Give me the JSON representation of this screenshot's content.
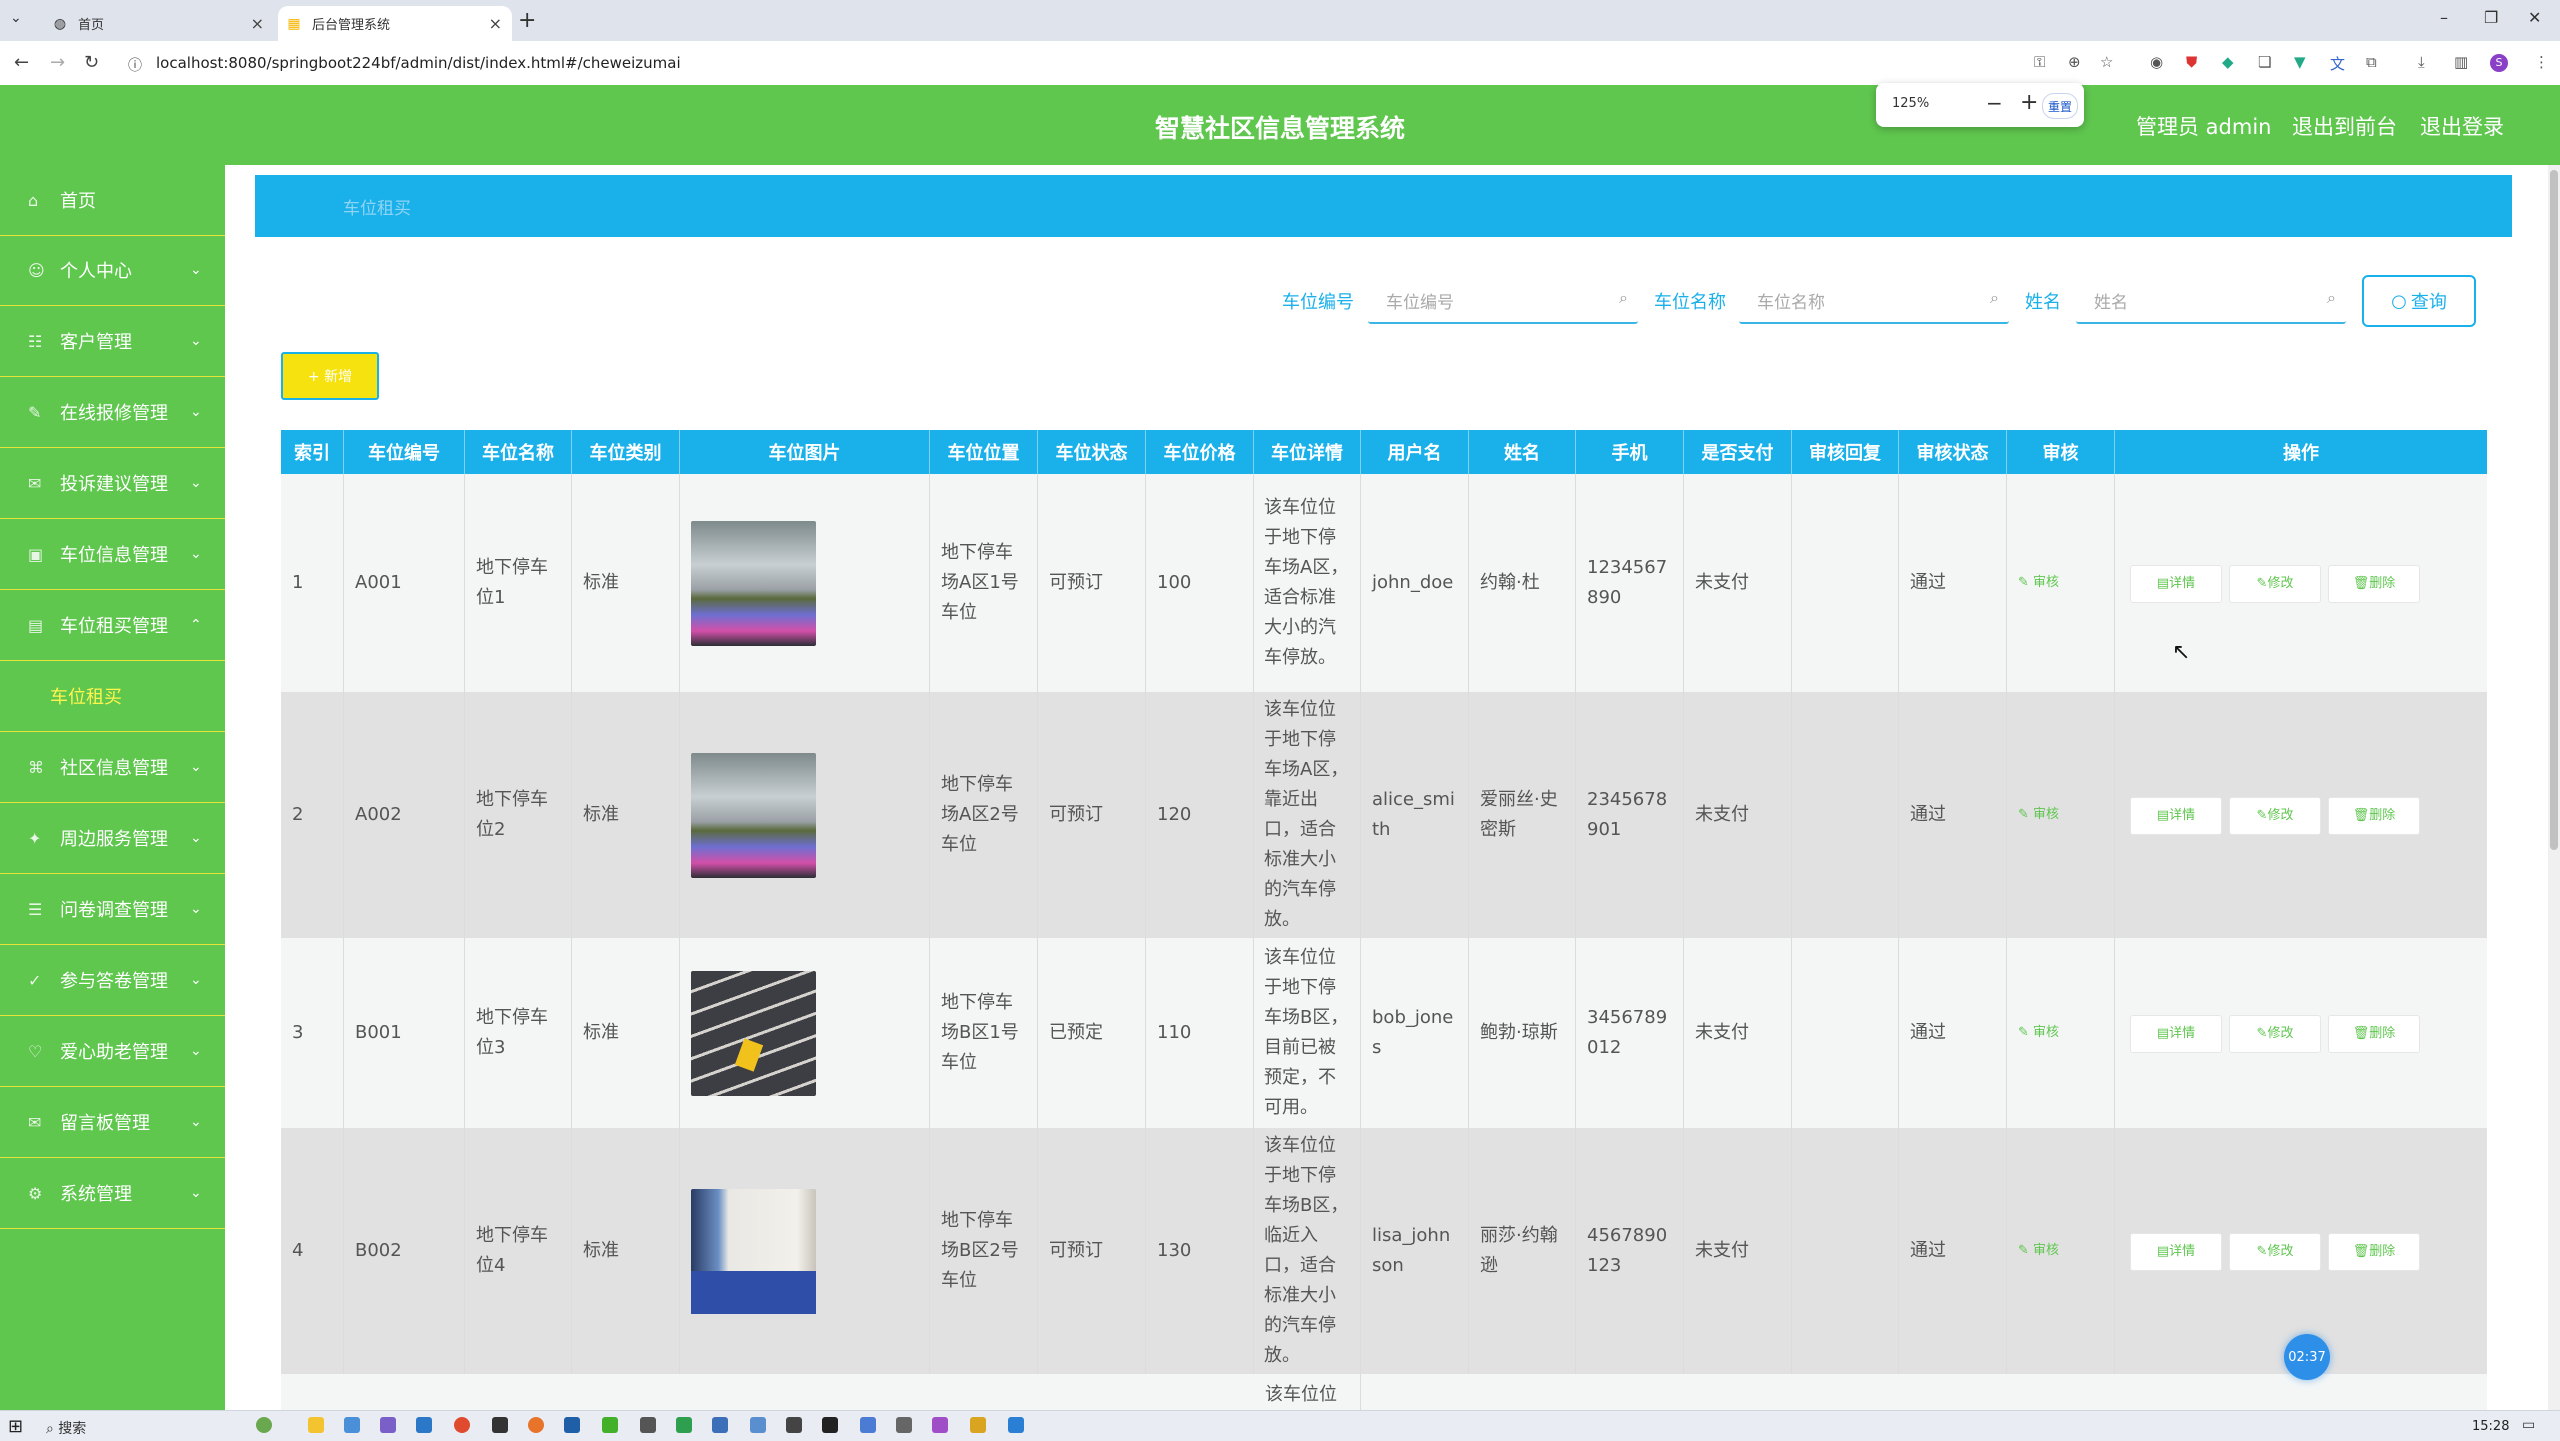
{
  "browser": {
    "tabs": [
      {
        "title": "首页",
        "active": false
      },
      {
        "title": "后台管理系统",
        "active": true
      }
    ],
    "url": "localhost:8080/springboot224bf/admin/dist/index.html#/cheweizumai",
    "zoom": {
      "value": "125%",
      "reset_label": "重置"
    }
  },
  "header": {
    "title": "智慧社区信息管理系统",
    "admin_label": "管理员 admin",
    "front_link": "退出到前台",
    "logout_link": "退出登录"
  },
  "sidebar": {
    "items": [
      {
        "label": "首页",
        "icon": "home-icon",
        "expandable": false
      },
      {
        "label": "个人中心",
        "icon": "user-icon",
        "expandable": true
      },
      {
        "label": "客户管理",
        "icon": "clients-icon",
        "expandable": true
      },
      {
        "label": "在线报修管理",
        "icon": "repair-icon",
        "expandable": true
      },
      {
        "label": "投诉建议管理",
        "icon": "complaint-icon",
        "expandable": true
      },
      {
        "label": "车位信息管理",
        "icon": "parking-icon",
        "expandable": true
      },
      {
        "label": "车位租买管理",
        "icon": "parking-rent-icon",
        "expandable": true,
        "expanded": true
      },
      {
        "label": "社区信息管理",
        "icon": "community-icon",
        "expandable": true
      },
      {
        "label": "周边服务管理",
        "icon": "service-icon",
        "expandable": true
      },
      {
        "label": "问卷调查管理",
        "icon": "survey-icon",
        "expandable": true
      },
      {
        "label": "参与答卷管理",
        "icon": "answer-icon",
        "expandable": true
      },
      {
        "label": "爱心助老管理",
        "icon": "heart-icon",
        "expandable": true
      },
      {
        "label": "留言板管理",
        "icon": "message-icon",
        "expandable": true
      },
      {
        "label": "系统管理",
        "icon": "system-icon",
        "expandable": true
      }
    ],
    "subitem": "车位租买"
  },
  "breadcrumb": "车位租买",
  "filters": {
    "fields": [
      {
        "label": "车位编号",
        "placeholder": "车位编号"
      },
      {
        "label": "车位名称",
        "placeholder": "车位名称"
      },
      {
        "label": "姓名",
        "placeholder": "姓名"
      }
    ],
    "search_label": "查询",
    "add_label": "+ 新增"
  },
  "table": {
    "headers": [
      "索引",
      "车位编号",
      "车位名称",
      "车位类别",
      "车位图片",
      "车位位置",
      "车位状态",
      "车位价格",
      "车位详情",
      "用户名",
      "姓名",
      "手机",
      "是否支付",
      "审核回复",
      "审核状态",
      "审核",
      "操作"
    ],
    "audit_label": "审核",
    "op_labels": {
      "detail": "详情",
      "edit": "修改",
      "delete": "删除"
    },
    "rows": [
      {
        "index": "1",
        "code": "A001",
        "name": "地下停车位1",
        "category": "标准",
        "location": "地下停车场A区1号车位",
        "status": "可预订",
        "price": "100",
        "detail": "该车位位于地下停车场A区，适合标准大小的汽车停放。",
        "username": "john_doe",
        "realname": "约翰·杜",
        "phone": "1234567890",
        "paid": "未支付",
        "reply": "",
        "review": "通过"
      },
      {
        "index": "2",
        "code": "A002",
        "name": "地下停车位2",
        "category": "标准",
        "location": "地下停车场A区2号车位",
        "status": "可预订",
        "price": "120",
        "detail": "该车位位于地下停车场A区，靠近出口，适合标准大小的汽车停放。",
        "username": "alice_smith",
        "realname": "爱丽丝·史密斯",
        "phone": "2345678901",
        "paid": "未支付",
        "reply": "",
        "review": "通过"
      },
      {
        "index": "3",
        "code": "B001",
        "name": "地下停车位3",
        "category": "标准",
        "location": "地下停车场B区1号车位",
        "status": "已预定",
        "price": "110",
        "detail": "该车位位于地下停车场B区，目前已被预定，不可用。",
        "username": "bob_jones",
        "realname": "鲍勃·琼斯",
        "phone": "3456789012",
        "paid": "未支付",
        "reply": "",
        "review": "通过"
      },
      {
        "index": "4",
        "code": "B002",
        "name": "地下停车位4",
        "category": "标准",
        "location": "地下停车场B区2号车位",
        "status": "可预订",
        "price": "130",
        "detail": "该车位位于地下停车场B区，临近入口，适合标准大小的汽车停放。",
        "username": "lisa_johnson",
        "realname": "丽莎·约翰逊",
        "phone": "4567890123",
        "paid": "未支付",
        "reply": "",
        "review": "通过"
      },
      {
        "detail_partial": "该车位位"
      }
    ]
  },
  "bubble_time": "02:37",
  "taskbar": {
    "search": "搜索",
    "clock": "15:28"
  },
  "colors": {
    "primary_green": "#5fc64e",
    "accent_blue": "#1ab0ea",
    "sub_yellow": "#fff54d",
    "add_button": "#f6e20e"
  }
}
